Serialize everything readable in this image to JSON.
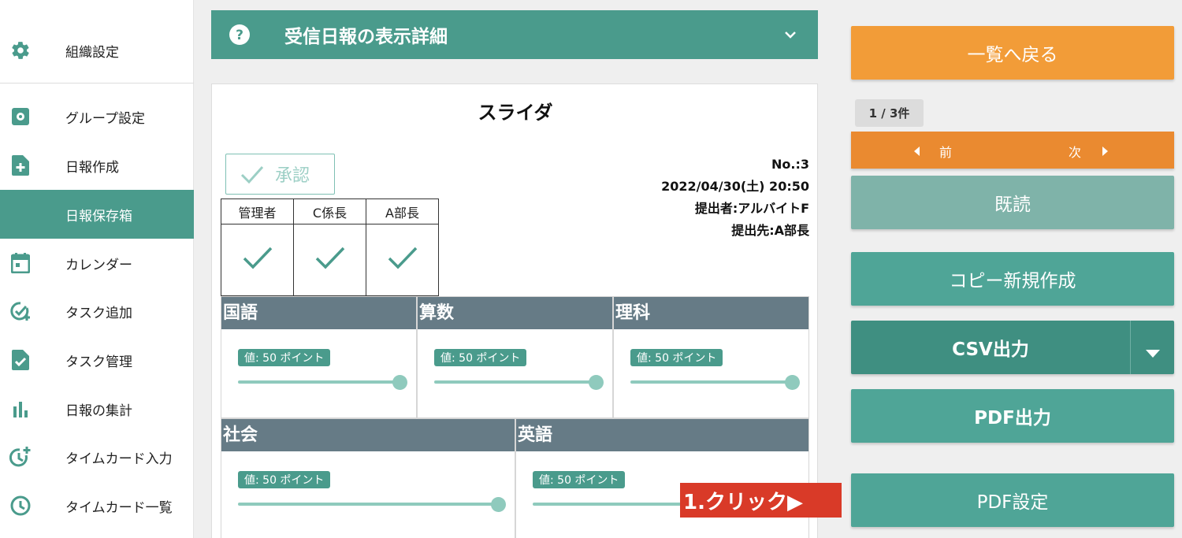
{
  "sidebar": {
    "items": [
      {
        "label": "組織設定",
        "icon": "gear-icon"
      },
      {
        "label": "グループ設定",
        "icon": "group-settings-icon"
      },
      {
        "label": "日報作成",
        "icon": "file-add-icon"
      },
      {
        "label": "日報保存箱",
        "icon": "",
        "active": true
      },
      {
        "label": "カレンダー",
        "icon": "calendar-icon"
      },
      {
        "label": "タスク追加",
        "icon": "task-add-icon"
      },
      {
        "label": "タスク管理",
        "icon": "task-file-icon"
      },
      {
        "label": "日報の集計",
        "icon": "bar-chart-icon"
      },
      {
        "label": "タイムカード入力",
        "icon": "clock-add-icon"
      },
      {
        "label": "タイムカード一覧",
        "icon": "clock-icon"
      }
    ]
  },
  "header": {
    "title": "受信日報の表示詳細",
    "help_icon": "question-icon",
    "chevron_icon": "chevron-down-icon"
  },
  "report": {
    "title": "スライダ",
    "approve_label": "承認",
    "approvers": [
      "管理者",
      "C係長",
      "A部長"
    ],
    "meta": {
      "no": "No.:3",
      "datetime": "2022/04/30(土) 20:50",
      "submitter": "提出者:アルバイトF",
      "recipient": "提出先:A部長"
    },
    "subjects": [
      {
        "name": "国語",
        "value_label": "値: 50 ポイント",
        "value": 50
      },
      {
        "name": "算数",
        "value_label": "値: 50 ポイント",
        "value": 50
      },
      {
        "name": "理科",
        "value_label": "値: 50 ポイント",
        "value": 50
      },
      {
        "name": "社会",
        "value_label": "値: 50 ポイント",
        "value": 50
      },
      {
        "name": "英語",
        "value_label": "値: 50 ポイント",
        "value": 50
      }
    ]
  },
  "actions": {
    "back": "一覧へ戻る",
    "count": "1 / 3件",
    "prev": "前",
    "next": "次",
    "read": "既読",
    "copy": "コピー新規作成",
    "csv": "CSV出力",
    "pdf": "PDF出力",
    "pdf_settings": "PDF設定"
  },
  "callout": "1.クリック▶",
  "colors": {
    "teal": "#4a9b8c",
    "orange": "#f29c38",
    "dark_orange": "#ea8a30",
    "slate": "#667b86",
    "red": "#d93a28"
  }
}
